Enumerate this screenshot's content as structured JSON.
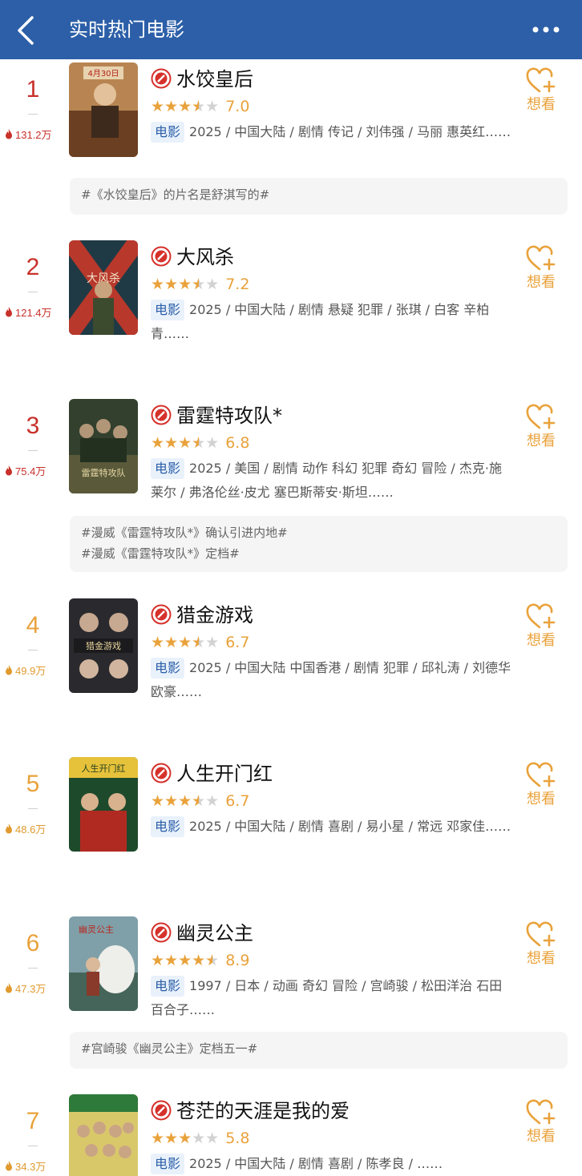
{
  "navbar": {
    "title": "实时热门电影",
    "more": "•••"
  },
  "labels": {
    "want": "想看",
    "type_tag": "电影"
  },
  "colors": {
    "nav_bg": "#2c5fa8",
    "rank_top": "#c8302a",
    "rank_mid": "#e9a23b",
    "star": "#e9a23b",
    "tag_bg": "#e9f1fb"
  },
  "movies": [
    {
      "rank": "1",
      "heat": "131.2万",
      "title": "水饺皇后",
      "stars": 3.5,
      "score": "7.0",
      "info": "2025 / 中国大陆 / 剧情 传记 / 刘伟强 / 马丽 惠英红……",
      "poster_text": "4月30日",
      "topics": [
        "#《水饺皇后》的片名是舒淇写的#"
      ]
    },
    {
      "rank": "2",
      "heat": "121.4万",
      "title": "大风杀",
      "stars": 3.5,
      "score": "7.2",
      "info": "2025 / 中国大陆 / 剧情 悬疑 犯罪 / 张琪 / 白客 辛柏青……",
      "poster_text": "大风杀",
      "topics": []
    },
    {
      "rank": "3",
      "heat": "75.4万",
      "title": "雷霆特攻队*",
      "stars": 3.5,
      "score": "6.8",
      "info": "2025 / 美国 / 剧情 动作 科幻 犯罪 奇幻 冒险 / 杰克·施莱尔 / 弗洛伦丝·皮尤 塞巴斯蒂安·斯坦……",
      "poster_text": "雷霆特攻队",
      "topics": [
        "#漫威《雷霆特攻队*》确认引进内地#",
        "#漫威《雷霆特攻队*》定档#"
      ]
    },
    {
      "rank": "4",
      "heat": "49.9万",
      "title": "猎金游戏",
      "stars": 3.5,
      "score": "6.7",
      "info": "2025 / 中国大陆 中国香港 / 剧情 犯罪 / 邱礼涛 / 刘德华 欧豪……",
      "poster_text": "猎金游戏",
      "topics": []
    },
    {
      "rank": "5",
      "heat": "48.6万",
      "title": "人生开门红",
      "stars": 3.5,
      "score": "6.7",
      "info": "2025 / 中国大陆 / 剧情 喜剧 / 易小星 / 常远 邓家佳……",
      "poster_text": "人生开门红",
      "topics": []
    },
    {
      "rank": "6",
      "heat": "47.3万",
      "title": "幽灵公主",
      "stars": 4.5,
      "score": "8.9",
      "info": "1997 / 日本 / 动画 奇幻 冒险 / 宫崎骏 / 松田洋治 石田百合子……",
      "poster_text": "幽灵公主",
      "topics": [
        "#宫崎骏《幽灵公主》定档五一#"
      ]
    },
    {
      "rank": "7",
      "heat": "34.3万",
      "title": "苍茫的天涯是我的爱",
      "stars": 3,
      "score": "5.8",
      "info": "2025 / 中国大陆 / 剧情 喜剧 / 陈孝良 / ……",
      "poster_text": "",
      "topics": []
    }
  ]
}
